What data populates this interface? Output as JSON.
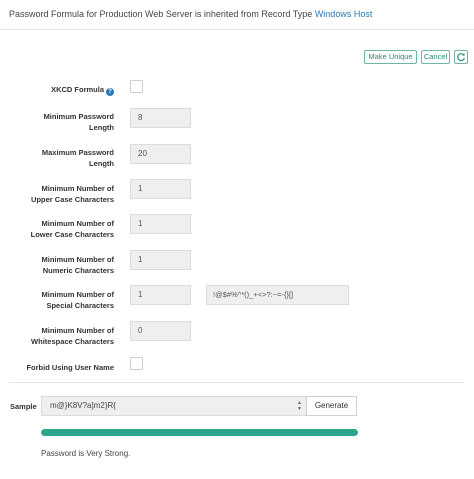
{
  "header": {
    "prefix": "Password Formula for Production Web Server is inherited from Record Type",
    "link": "Windows Host"
  },
  "toolbar": {
    "make_unique": "Make Unique",
    "cancel": "Cancel",
    "refresh_icon": "refresh-icon"
  },
  "fields": {
    "xkcd": {
      "label": "XKCD Formula",
      "help_icon": "?"
    },
    "min_length": {
      "label_1": "Minimum Password",
      "label_2": "Length",
      "value": "8"
    },
    "max_length": {
      "label_1": "Maximum Password",
      "label_2": "Length",
      "value": "20"
    },
    "min_upper": {
      "label_1": "Minimum Number of",
      "label_2": "Upper Case Characters",
      "value": "1"
    },
    "min_lower": {
      "label_1": "Minimum Number of",
      "label_2": "Lower Case Characters",
      "value": "1"
    },
    "min_numeric": {
      "label_1": "Minimum Number of",
      "label_2": "Numeric Characters",
      "value": "1"
    },
    "min_special": {
      "label_1": "Minimum Number of",
      "label_2": "Special Characters",
      "value": "1",
      "allowed": "!@$#%^*()_+<>?:~=-{}[]"
    },
    "min_whitespace": {
      "label_1": "Minimum Number of",
      "label_2": "Whitespace Characters",
      "value": "0"
    },
    "forbid_username": {
      "label": "Forbid Using User Name"
    }
  },
  "sample": {
    "label": "Sample",
    "value": "m@}K8V?a]m2}R{",
    "generate": "Generate",
    "strength_fraction": 1.0,
    "strength_text": "Password is Very Strong."
  },
  "colors": {
    "accent": "#2ba48a",
    "link": "#2a7ab8"
  }
}
